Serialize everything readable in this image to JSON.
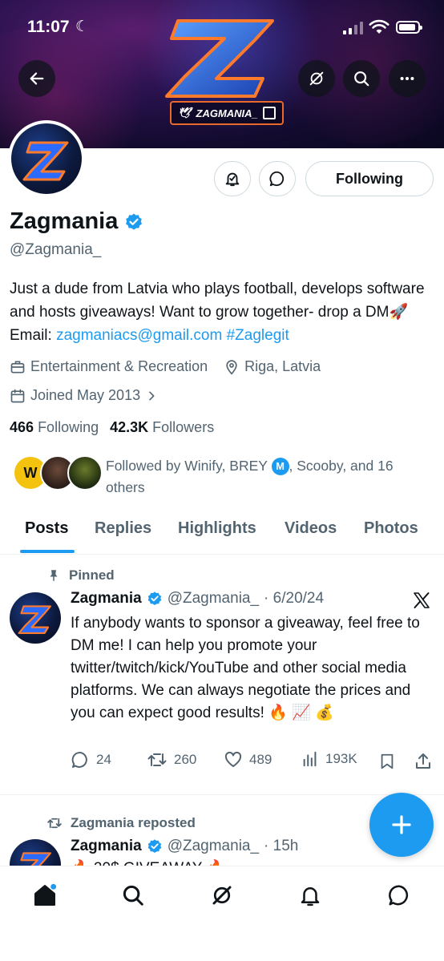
{
  "status_bar": {
    "time": "11:07"
  },
  "banner": {
    "tag_text": "ZAGMANIA_"
  },
  "profile": {
    "display_name": "Zagmania",
    "handle": "@Zagmania_",
    "follow_button": "Following",
    "bio_text": "Just a dude from Latvia who plays football, develops software and hosts giveaways! Want to grow together- drop a DM",
    "bio_emoji": "🚀",
    "bio_email_label": " Email: ",
    "bio_email": "zagmaniacs@gmail.com",
    "bio_hashtag": "#Zaglegit",
    "category": "Entertainment & Recreation",
    "location": "Riga, Latvia",
    "joined": "Joined May 2013",
    "following_count": "466",
    "following_label": "Following",
    "followers_count": "42.3K",
    "followers_label": "Followers",
    "followed_by_prefix": "Followed by Winify, BREY",
    "followed_by_badge": "M",
    "followed_by_suffix": ", Scooby, and 16 others"
  },
  "tabs": [
    "Posts",
    "Replies",
    "Highlights",
    "Videos",
    "Photos"
  ],
  "active_tab": "Posts",
  "pinned_tweet": {
    "pinned_label": "Pinned",
    "author": "Zagmania",
    "handle": "@Zagmania_",
    "date": "· 6/20/24",
    "text": "If anybody wants to sponsor a giveaway, feel free to DM me! I can help you promote your twitter/twitch/kick/YouTube and other social media platforms. We can always negotiate the prices and you can expect good results! 🔥 📈 💰",
    "replies": "24",
    "reposts": "260",
    "likes": "489",
    "views": "193K"
  },
  "second_tweet": {
    "repost_label": "Zagmania reposted",
    "author": "Zagmania",
    "handle": "@Zagmania_",
    "time": "· 15h",
    "text_preview": "🔥 20$ GIVEAWAY 🔥"
  },
  "icons": {
    "back": "back-arrow-icon",
    "grok": "grok-icon",
    "search": "search-icon",
    "more": "more-icon",
    "bell_plus": "notification-bell-icon",
    "message": "message-icon",
    "x_logo": "x-logo-icon"
  },
  "colors": {
    "accent": "#1d9bf0",
    "text": "#0f1419",
    "muted": "#536471"
  }
}
